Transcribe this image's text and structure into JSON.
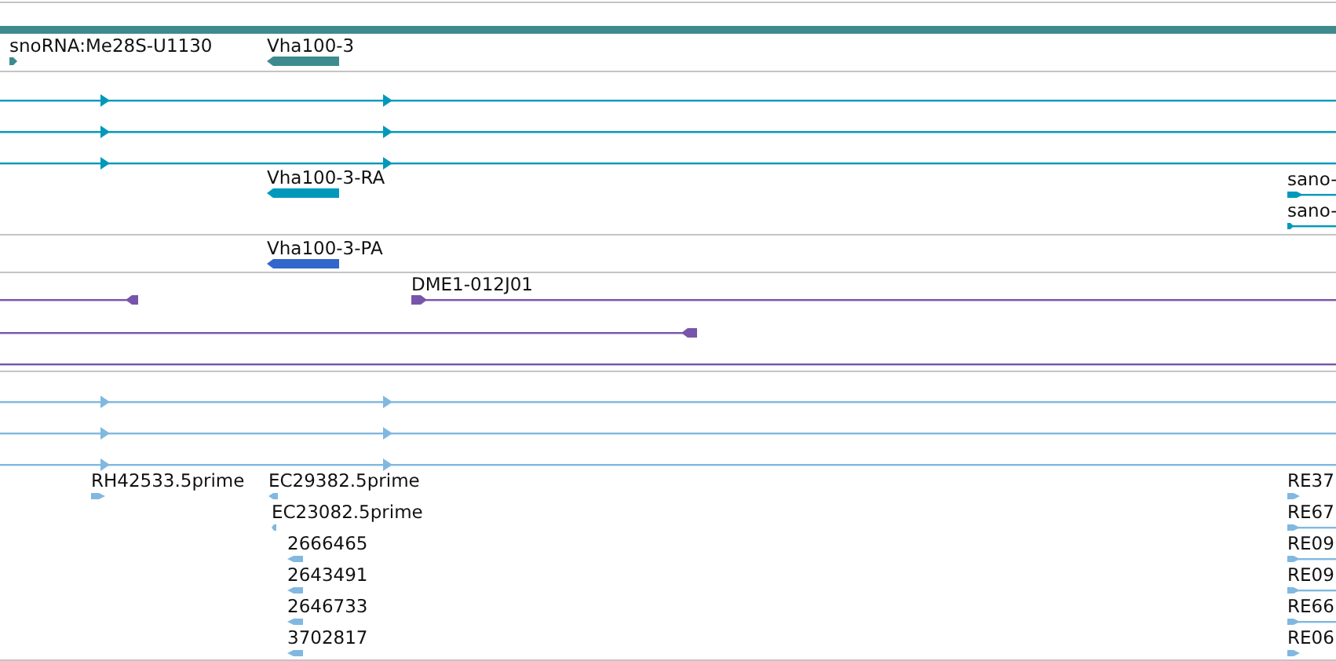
{
  "tracks": [
    {
      "color": "#3d8b8f",
      "features": [
        {
          "kind": "bar"
        },
        {
          "label": "snoRNA:Me28S-U1130",
          "kind": "tick",
          "reverse": false
        },
        {
          "label": "Vha100-3",
          "kind": "box",
          "reverse": true
        }
      ]
    },
    {
      "color": "#0099bb",
      "features": [
        {
          "kind": "line",
          "reverse": false
        },
        {
          "kind": "line",
          "reverse": false
        },
        {
          "kind": "line",
          "reverse": false
        },
        {
          "label": "Vha100-3-RA",
          "kind": "box",
          "reverse": true
        },
        {
          "label": "sano-",
          "kind": "tick",
          "reverse": false
        },
        {
          "label": "sano-",
          "kind": "tick",
          "reverse": false
        }
      ]
    },
    {
      "color": "#3366cc",
      "features": [
        {
          "label": "Vha100-3-PA",
          "kind": "box",
          "reverse": true
        }
      ]
    },
    {
      "color": "#7755aa",
      "features": [
        {
          "kind": "tick",
          "reverse": true
        },
        {
          "label": "DME1-012J01",
          "kind": "tick",
          "reverse": false
        },
        {
          "kind": "tick",
          "reverse": true
        },
        {
          "kind": "line"
        }
      ]
    },
    {
      "color": "#80b8e0",
      "features": [
        {
          "kind": "line",
          "reverse": false
        },
        {
          "kind": "line",
          "reverse": false
        },
        {
          "kind": "line",
          "reverse": false
        },
        {
          "label": "RH42533.5prime",
          "kind": "tick",
          "reverse": false
        },
        {
          "label": "EC29382.5prime",
          "kind": "tick",
          "reverse": true
        },
        {
          "label": "EC23082.5prime",
          "kind": "tick",
          "reverse": true
        },
        {
          "label": "2666465",
          "kind": "tick",
          "reverse": true
        },
        {
          "label": "2643491",
          "kind": "tick",
          "reverse": true
        },
        {
          "label": "2646733",
          "kind": "tick",
          "reverse": true
        },
        {
          "label": "3702817",
          "kind": "tick",
          "reverse": true
        },
        {
          "label": "RE37",
          "kind": "tick",
          "reverse": false
        },
        {
          "label": "RE67",
          "kind": "tick",
          "reverse": false
        },
        {
          "label": "RE09",
          "kind": "tick",
          "reverse": false
        },
        {
          "label": "RE09",
          "kind": "tick",
          "reverse": false
        },
        {
          "label": "RE66",
          "kind": "tick",
          "reverse": false
        },
        {
          "label": "RE06",
          "kind": "tick",
          "reverse": false
        }
      ]
    }
  ]
}
